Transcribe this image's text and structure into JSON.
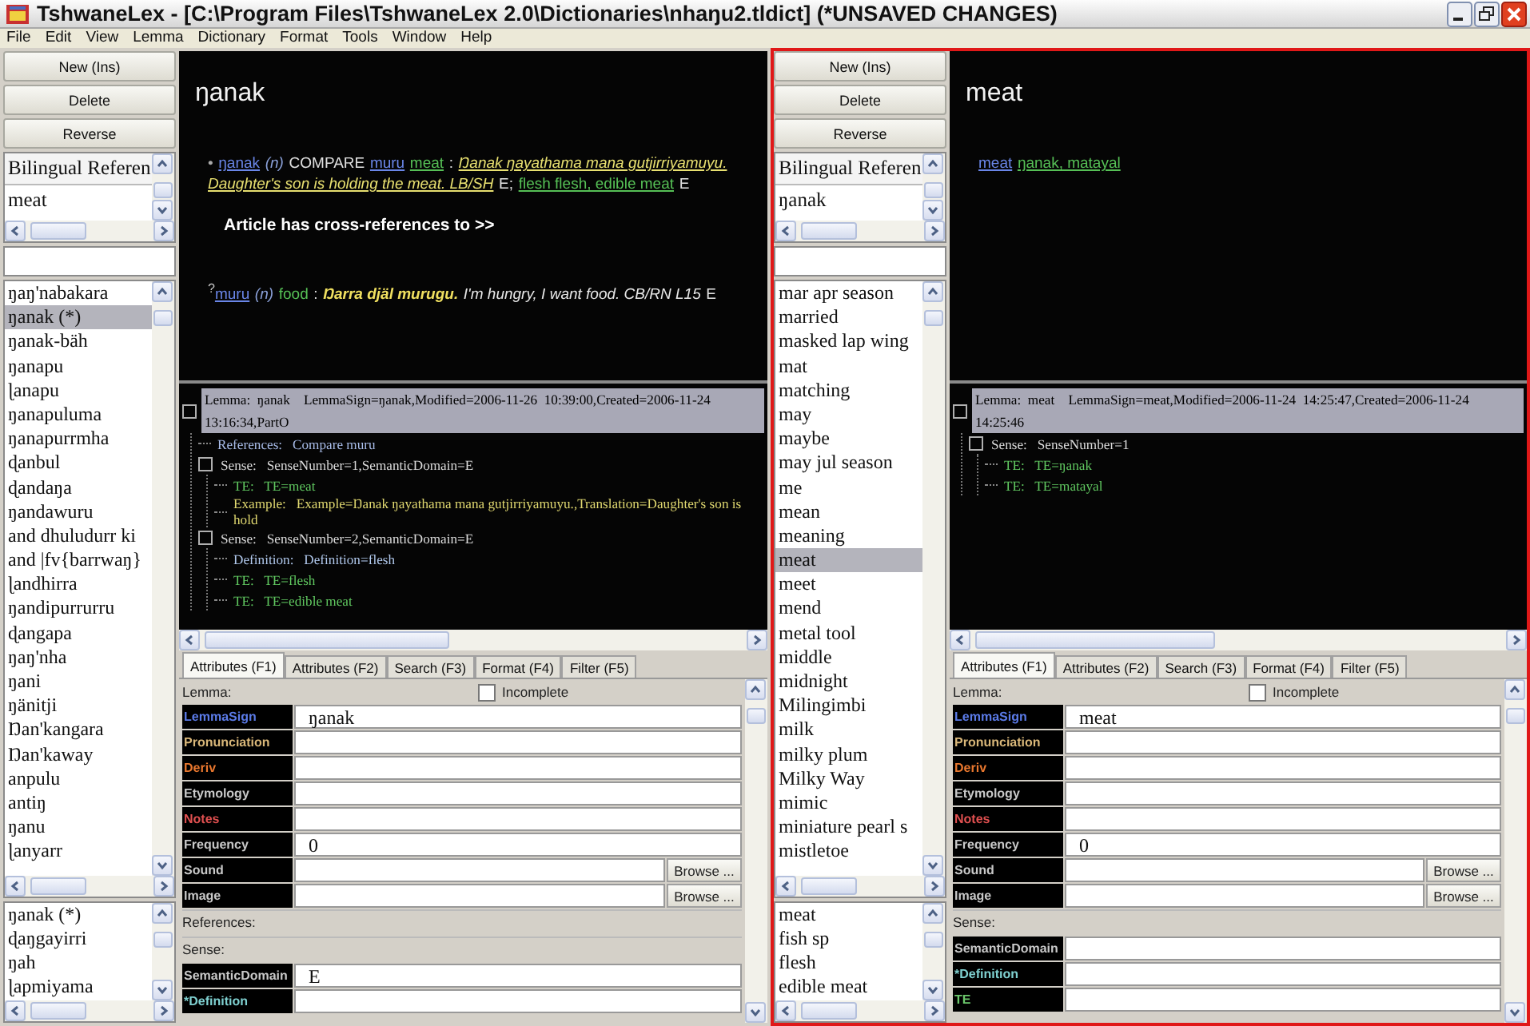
{
  "window": {
    "title": "TshwaneLex - [C:\\Program Files\\TshwaneLex 2.0\\Dictionaries\\nhaŋu2.tldict] (*UNSAVED CHANGES)"
  },
  "menu": [
    "File",
    "Edit",
    "View",
    "Lemma",
    "Dictionary",
    "Format",
    "Tools",
    "Window",
    "Help"
  ],
  "panes": [
    {
      "active": false,
      "buttons": [
        "New (Ins)",
        "Delete",
        "Reverse"
      ],
      "reference_list": [
        "Bilingual Referen",
        "meat"
      ],
      "lemma_list": [
        {
          "text": "ŋaŋ'nabakara",
          "selected": false
        },
        {
          "text": "ŋanak (*)",
          "selected": true
        },
        {
          "text": "ŋanak-bäh",
          "selected": false
        },
        {
          "text": "ŋanapu",
          "selected": false
        },
        {
          "text": "ɭanapu",
          "selected": false
        },
        {
          "text": "ŋanapuluma",
          "selected": false
        },
        {
          "text": "ŋanapurrmha",
          "selected": false
        },
        {
          "text": "ɖanbul",
          "selected": false
        },
        {
          "text": "ɖandaŋa",
          "selected": false
        },
        {
          "text": "ŋandawuru",
          "selected": false
        },
        {
          "text": "and dhuludurr ki",
          "selected": false
        },
        {
          "text": "and |fv{barrwaŋ}",
          "selected": false
        },
        {
          "text": "ɭandhirra",
          "selected": false
        },
        {
          "text": "ŋandipurrurru",
          "selected": false
        },
        {
          "text": "ɖangapa",
          "selected": false
        },
        {
          "text": "ŋaŋ'nha",
          "selected": false
        },
        {
          "text": "ŋani",
          "selected": false
        },
        {
          "text": "ŋänitji",
          "selected": false
        },
        {
          "text": "Ŋan'kangara",
          "selected": false
        },
        {
          "text": "Ŋan'kaway",
          "selected": false
        },
        {
          "text": "anpulu",
          "selected": false
        },
        {
          "text": "antiŋ",
          "selected": false
        },
        {
          "text": "ŋanu",
          "selected": false
        },
        {
          "text": "ɭanyarr",
          "selected": false
        }
      ],
      "sub_list": [
        {
          "text": "ŋanak (*)",
          "selected": false
        },
        {
          "text": "ɖaŋgayirri",
          "selected": false
        },
        {
          "text": "ŋah",
          "selected": false
        },
        {
          "text": "ɭapmiyama",
          "selected": false
        }
      ],
      "article": {
        "heading": "ŋanak",
        "entries": [
          {
            "kind": "sense",
            "segments": [
              {
                "kind": "bullet",
                "text": "•"
              },
              {
                "kind": "link",
                "text": "ŋanak"
              },
              {
                "kind": "pos",
                "text": "(n)"
              },
              {
                "kind": "plain",
                "text": "COMPARE"
              },
              {
                "kind": "link",
                "text": "muru"
              },
              {
                "kind": "gloss",
                "text": "meat"
              },
              {
                "kind": "plain",
                "text": ":"
              },
              {
                "kind": "example",
                "text": "Ŋanak ŋayathama mana gutjirriyamuyu. Daughter's son is holding the meat. LB/SH"
              },
              {
                "kind": "plain",
                "text": "E;"
              },
              {
                "kind": "gloss",
                "text": "flesh flesh, edible meat"
              },
              {
                "kind": "plain",
                "text": "E"
              }
            ]
          },
          {
            "kind": "note",
            "segments": [
              {
                "kind": "bold",
                "text": "Article has cross-references to >>"
              }
            ]
          },
          {
            "kind": "sense",
            "segments": [
              {
                "kind": "sup",
                "text": "?"
              },
              {
                "kind": "link",
                "text": "muru"
              },
              {
                "kind": "pos",
                "text": "(n)"
              },
              {
                "kind": "gloss_plain",
                "text": "food"
              },
              {
                "kind": "plain",
                "text": ":"
              },
              {
                "kind": "example_bold",
                "text": "Ŋarra djäl murugu."
              },
              {
                "kind": "translation",
                "text": "I'm hungry, I want food. CB/RN L15"
              },
              {
                "kind": "plain",
                "text": "E"
              }
            ]
          }
        ]
      },
      "tree": [
        {
          "kind": "lemma",
          "text": "Lemma:  ŋanak    LemmaSign=ŋanak,Modified=2006-11-26  10:39:00,Created=2006-11-24  13:16:34,PartO",
          "children": [
            {
              "kind": "references",
              "text": "References:   Compare muru"
            },
            {
              "kind": "sense",
              "text": "Sense:   SenseNumber=1,SemanticDomain=E",
              "children": [
                {
                  "kind": "te",
                  "text": "TE:   TE=meat"
                },
                {
                  "kind": "example",
                  "text": "Example:   Example=Ŋanak ŋayathama mana gutjirriyamuyu.,Translation=Daughter's son is hold"
                }
              ]
            },
            {
              "kind": "sense",
              "text": "Sense:   SenseNumber=2,SemanticDomain=E",
              "children": [
                {
                  "kind": "definition",
                  "text": "Definition:   Definition=flesh"
                },
                {
                  "kind": "te",
                  "text": "TE:   TE=flesh"
                },
                {
                  "kind": "te",
                  "text": "TE:   TE=edible meat"
                }
              ]
            }
          ]
        }
      ],
      "tabs": [
        {
          "label": "Attributes (F1)",
          "selected": true
        },
        {
          "label": "Attributes (F2)",
          "selected": false
        },
        {
          "label": "Search (F3)",
          "selected": false
        },
        {
          "label": "Format (F4)",
          "selected": false
        },
        {
          "label": "Filter (F5)",
          "selected": false
        }
      ],
      "form": {
        "heading": "Lemma:",
        "incomplete": {
          "label": "Incomplete",
          "checked": false
        },
        "rows": [
          {
            "kind": "field",
            "label": "LemmaSign",
            "color": "#5b7be8",
            "value": "ŋanak"
          },
          {
            "kind": "field",
            "label": "Pronunciation",
            "color": "#d9b779"
          },
          {
            "kind": "field",
            "label": "Deriv",
            "color": "#e8772e"
          },
          {
            "kind": "field",
            "label": "Etymology",
            "color": "#c8c8c8"
          },
          {
            "kind": "field",
            "label": "Notes",
            "color": "#e05050"
          },
          {
            "kind": "field",
            "label": "Frequency",
            "color": "#c8c8c8",
            "value": "0"
          },
          {
            "kind": "file",
            "label": "Sound",
            "color": "#c8c8c8",
            "button": "Browse ..."
          },
          {
            "kind": "file",
            "label": "Image",
            "color": "#c8c8c8",
            "button": "Browse ..."
          },
          {
            "kind": "section",
            "label": "References:"
          },
          {
            "kind": "section",
            "label": "Sense:"
          },
          {
            "kind": "field",
            "label": "SemanticDomain",
            "color": "#c8c8c8",
            "value": "E"
          },
          {
            "kind": "field",
            "label": "*Definition",
            "color": "#7fd0d0"
          }
        ]
      }
    },
    {
      "active": true,
      "buttons": [
        "New (Ins)",
        "Delete",
        "Reverse"
      ],
      "reference_list": [
        "Bilingual Referen",
        "ŋanak"
      ],
      "lemma_list": [
        {
          "text": "mar apr season",
          "selected": false
        },
        {
          "text": "married",
          "selected": false
        },
        {
          "text": "masked lap wing",
          "selected": false
        },
        {
          "text": "mat",
          "selected": false
        },
        {
          "text": "matching",
          "selected": false
        },
        {
          "text": "may",
          "selected": false
        },
        {
          "text": "maybe",
          "selected": false
        },
        {
          "text": "may jul season",
          "selected": false
        },
        {
          "text": "me",
          "selected": false
        },
        {
          "text": "mean",
          "selected": false
        },
        {
          "text": "meaning",
          "selected": false
        },
        {
          "text": "meat",
          "selected": true
        },
        {
          "text": "meet",
          "selected": false
        },
        {
          "text": "mend",
          "selected": false
        },
        {
          "text": "metal tool",
          "selected": false
        },
        {
          "text": "middle",
          "selected": false
        },
        {
          "text": "midnight",
          "selected": false
        },
        {
          "text": "Milingimbi",
          "selected": false
        },
        {
          "text": "milk",
          "selected": false
        },
        {
          "text": "milky plum",
          "selected": false
        },
        {
          "text": "Milky Way",
          "selected": false
        },
        {
          "text": "mimic",
          "selected": false
        },
        {
          "text": "miniature pearl s",
          "selected": false
        },
        {
          "text": "mistletoe",
          "selected": false
        }
      ],
      "sub_list": [
        {
          "text": "meat",
          "selected": false
        },
        {
          "text": "fish sp",
          "selected": false
        },
        {
          "text": "flesh",
          "selected": false
        },
        {
          "text": "edible meat",
          "selected": false
        }
      ],
      "article": {
        "heading": "meat",
        "entries": [
          {
            "kind": "sense",
            "segments": [
              {
                "kind": "link",
                "text": "meat"
              },
              {
                "kind": "gloss",
                "text": "ŋanak, matayal"
              }
            ]
          }
        ]
      },
      "tree": [
        {
          "kind": "lemma",
          "text": "Lemma:  meat    LemmaSign=meat,Modified=2006-11-24  14:25:47,Created=2006-11-24  14:25:46",
          "children": [
            {
              "kind": "sense",
              "text": "Sense:   SenseNumber=1",
              "children": [
                {
                  "kind": "te",
                  "text": "TE:   TE=ŋanak"
                },
                {
                  "kind": "te",
                  "text": "TE:   TE=matayal"
                }
              ]
            }
          ]
        }
      ],
      "tabs": [
        {
          "label": "Attributes (F1)",
          "selected": true
        },
        {
          "label": "Attributes (F2)",
          "selected": false
        },
        {
          "label": "Search (F3)",
          "selected": false
        },
        {
          "label": "Format (F4)",
          "selected": false
        },
        {
          "label": "Filter (F5)",
          "selected": false
        }
      ],
      "form": {
        "heading": "Lemma:",
        "incomplete": {
          "label": "Incomplete",
          "checked": false
        },
        "rows": [
          {
            "kind": "field",
            "label": "LemmaSign",
            "color": "#5b7be8",
            "value": "meat"
          },
          {
            "kind": "field",
            "label": "Pronunciation",
            "color": "#d9b779"
          },
          {
            "kind": "field",
            "label": "Deriv",
            "color": "#e8772e"
          },
          {
            "kind": "field",
            "label": "Etymology",
            "color": "#c8c8c8"
          },
          {
            "kind": "field",
            "label": "Notes",
            "color": "#e05050"
          },
          {
            "kind": "field",
            "label": "Frequency",
            "color": "#c8c8c8",
            "value": "0"
          },
          {
            "kind": "file",
            "label": "Sound",
            "color": "#c8c8c8",
            "button": "Browse ..."
          },
          {
            "kind": "file",
            "label": "Image",
            "color": "#c8c8c8",
            "button": "Browse ..."
          },
          {
            "kind": "section",
            "label": "Sense:"
          },
          {
            "kind": "field",
            "label": "SemanticDomain",
            "color": "#c8c8c8"
          },
          {
            "kind": "field",
            "label": "*Definition",
            "color": "#7fd0d0"
          },
          {
            "kind": "field",
            "label": "TE",
            "color": "#6cc86c"
          }
        ]
      }
    }
  ]
}
